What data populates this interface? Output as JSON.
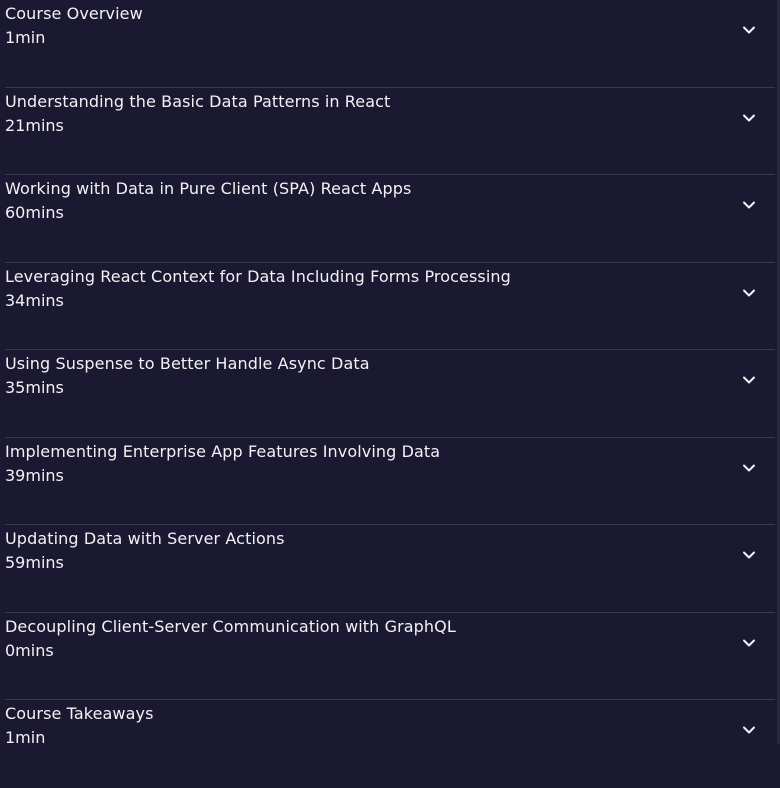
{
  "modules": [
    {
      "title": "Course Overview",
      "duration": "1min"
    },
    {
      "title": "Understanding the Basic Data Patterns in React",
      "duration": "21mins"
    },
    {
      "title": "Working with Data in Pure Client (SPA) React Apps",
      "duration": "60mins"
    },
    {
      "title": "Leveraging React Context for Data Including Forms Processing",
      "duration": "34mins"
    },
    {
      "title": "Using Suspense to Better Handle Async Data",
      "duration": "35mins"
    },
    {
      "title": "Implementing Enterprise App Features Involving Data",
      "duration": "39mins"
    },
    {
      "title": "Updating Data with Server Actions",
      "duration": "59mins"
    },
    {
      "title": "Decoupling Client-Server Communication with GraphQL",
      "duration": "0mins"
    },
    {
      "title": "Course Takeaways",
      "duration": "1min"
    }
  ],
  "icons": {
    "expand": "chevron-down-icon"
  },
  "colors": {
    "background": "#1b1932",
    "text": "#f2f2f5",
    "divider": "#3a3850"
  }
}
